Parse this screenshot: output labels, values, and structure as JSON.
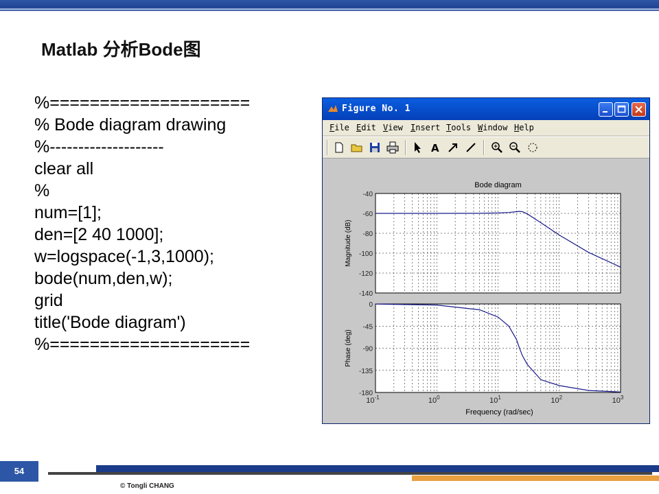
{
  "slide": {
    "title": "Matlab 分析Bode图",
    "code_lines": [
      "%====================",
      "% Bode diagram drawing",
      "%--------------------",
      "clear all",
      "%",
      "num=[1];",
      "den=[2 40 1000];",
      "w=logspace(-1,3,1000);",
      "bode(num,den,w);",
      "grid",
      "title('Bode diagram')",
      "%===================="
    ],
    "page_number": "54",
    "copyright": "© Tongli  CHANG"
  },
  "figure_window": {
    "title": "Figure No. 1",
    "menu": [
      "File",
      "Edit",
      "View",
      "Insert",
      "Tools",
      "Window",
      "Help"
    ],
    "toolbar_icons": [
      "new-file-icon",
      "open-folder-icon",
      "save-icon",
      "print-icon",
      "select-arrow-icon",
      "text-icon",
      "arrow-tool-icon",
      "line-tool-icon",
      "zoom-in-icon",
      "zoom-out-icon",
      "rotate-icon"
    ],
    "colors": {
      "title_bar": "#0a4fd6",
      "close_button": "#d4502c",
      "plot_line": "#1a1a8c"
    }
  },
  "chart_data": {
    "type": "line",
    "title": "Bode diagram",
    "xlabel": "Frequency  (rad/sec)",
    "xscale": "log",
    "xlim": [
      0.1,
      1000
    ],
    "x_tick_labels": [
      "10-1",
      "100",
      "101",
      "102",
      "103"
    ],
    "grid": true,
    "transfer_function": {
      "num": [
        1
      ],
      "den": [
        2,
        40,
        1000
      ]
    },
    "subplots": [
      {
        "name": "magnitude",
        "ylabel": "Magnitude (dB)",
        "ylim": [
          -140,
          -40
        ],
        "yticks": [
          "-40",
          "-60",
          "-80",
          "-100",
          "-120",
          "-140"
        ],
        "x": [
          0.1,
          1,
          5,
          10,
          15,
          20,
          22.4,
          25,
          30,
          50,
          100,
          300,
          1000
        ],
        "y": [
          -60,
          -60,
          -59.9,
          -59.6,
          -59.1,
          -58.3,
          -58,
          -58.3,
          -60.5,
          -69.4,
          -81.8,
          -99.2,
          -114
        ]
      },
      {
        "name": "phase",
        "ylabel": "Phase (deg)",
        "ylim": [
          -180,
          0
        ],
        "yticks": [
          "0",
          "-45",
          "-90",
          "-135",
          "-180"
        ],
        "x": [
          0.1,
          1,
          5,
          10,
          15,
          20,
          22.4,
          25,
          30,
          50,
          100,
          300,
          1000
        ],
        "y": [
          -0.2,
          -2.3,
          -11.9,
          -26.6,
          -45,
          -72.3,
          -90,
          -105,
          -123,
          -154,
          -166,
          -176,
          -179
        ]
      }
    ]
  }
}
